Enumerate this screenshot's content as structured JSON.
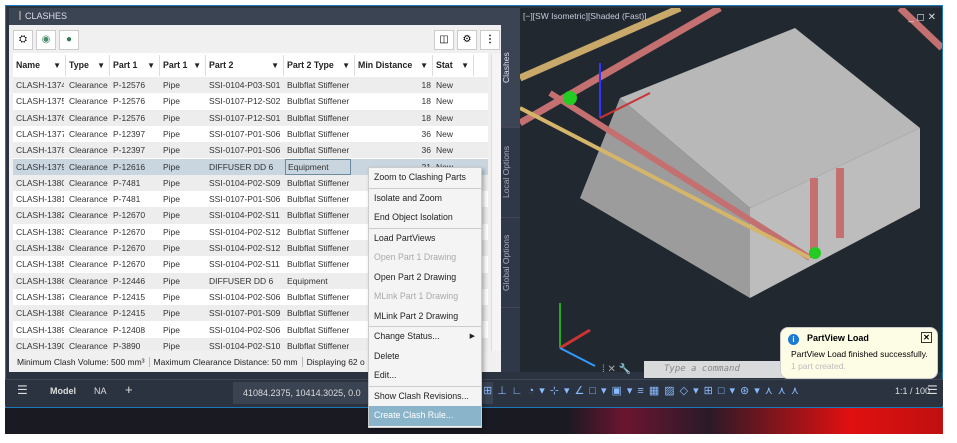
{
  "panel": {
    "title": "CLASHES",
    "toolbar_icons": [
      "clash-run-icon",
      "location-pin-icon",
      "globe-icon"
    ],
    "right_icons": [
      "columns-icon",
      "gear-icon",
      "more-vert-icon"
    ]
  },
  "columns": [
    "Name",
    "Type",
    "Part 1",
    "Part 1",
    "Part 2",
    "Part 2 Type",
    "Min Distance",
    "Stat"
  ],
  "rows": [
    [
      "CLASH-1374",
      "Clearance",
      "P-12576",
      "Pipe",
      "SSI-0104-P03-S01",
      "Bulbflat Stiffener",
      "18",
      "New"
    ],
    [
      "CLASH-1375",
      "Clearance",
      "P-12576",
      "Pipe",
      "SSI-0107-P12-S02",
      "Bulbflat Stiffener",
      "18",
      "New"
    ],
    [
      "CLASH-1376",
      "Clearance",
      "P-12576",
      "Pipe",
      "SSI-0107-P12-S01",
      "Bulbflat Stiffener",
      "18",
      "New"
    ],
    [
      "CLASH-1377",
      "Clearance",
      "P-12397",
      "Pipe",
      "SSI-0107-P01-S06",
      "Bulbflat Stiffener",
      "36",
      "New"
    ],
    [
      "CLASH-1378",
      "Clearance",
      "P-12397",
      "Pipe",
      "SSI-0107-P01-S06",
      "Bulbflat Stiffener",
      "36",
      "New"
    ],
    [
      "CLASH-1379",
      "Clearance",
      "P-12616",
      "Pipe",
      "DIFFUSER DD 6",
      "Equipment",
      "21",
      "New"
    ],
    [
      "CLASH-1380",
      "Clearance",
      "P-7481",
      "Pipe",
      "SSI-0104-P02-S09",
      "Bulbflat Stiffener",
      "",
      ""
    ],
    [
      "CLASH-1381",
      "Clearance",
      "P-7481",
      "Pipe",
      "SSI-0107-P01-S06",
      "Bulbflat Stiffener",
      "",
      ""
    ],
    [
      "CLASH-1382",
      "Clearance",
      "P-12670",
      "Pipe",
      "SSI-0104-P02-S11",
      "Bulbflat Stiffener",
      "",
      ""
    ],
    [
      "CLASH-1383",
      "Clearance",
      "P-12670",
      "Pipe",
      "SSI-0104-P02-S12",
      "Bulbflat Stiffener",
      "",
      ""
    ],
    [
      "CLASH-1384",
      "Clearance",
      "P-12670",
      "Pipe",
      "SSI-0104-P02-S12",
      "Bulbflat Stiffener",
      "",
      ""
    ],
    [
      "CLASH-1385",
      "Clearance",
      "P-12670",
      "Pipe",
      "SSI-0104-P02-S11",
      "Bulbflat Stiffener",
      "",
      ""
    ],
    [
      "CLASH-1386",
      "Clearance",
      "P-12446",
      "Pipe",
      "DIFFUSER DD 6",
      "Equipment",
      "",
      ""
    ],
    [
      "CLASH-1387",
      "Clearance",
      "P-12415",
      "Pipe",
      "SSI-0104-P02-S06",
      "Bulbflat Stiffener",
      "",
      ""
    ],
    [
      "CLASH-1388",
      "Clearance",
      "P-12415",
      "Pipe",
      "SSI-0107-P01-S09",
      "Bulbflat Stiffener",
      "",
      ""
    ],
    [
      "CLASH-1389",
      "Clearance",
      "P-12408",
      "Pipe",
      "SSI-0104-P02-S06",
      "Bulbflat Stiffener",
      "",
      ""
    ],
    [
      "CLASH-1390",
      "Clearance",
      "P-3890",
      "Pipe",
      "SSI-0104-P02-S10",
      "Bulbflat Stiffener",
      "",
      ""
    ]
  ],
  "selected_row": 5,
  "status": {
    "min_volume": "Minimum Clash Volume: 500 mm³",
    "max_clearance": "Maximum Clearance Distance: 50 mm",
    "displaying": "Displaying 62 o"
  },
  "side_tabs": [
    "Clashes",
    "Local Options",
    "Global Options"
  ],
  "viewport": {
    "label": "[−][SW Isometric][Shaded (Fast)]"
  },
  "context_menu": [
    {
      "label": "Zoom to Clashing Parts"
    },
    {
      "sep": true
    },
    {
      "label": "Isolate and Zoom"
    },
    {
      "label": "End Object Isolation"
    },
    {
      "sep": true
    },
    {
      "label": "Load PartViews"
    },
    {
      "label": "Open Part 1 Drawing",
      "disabled": true
    },
    {
      "label": "Open Part 2 Drawing"
    },
    {
      "label": "MLink Part 1 Drawing",
      "disabled": true
    },
    {
      "label": "MLink Part 2 Drawing"
    },
    {
      "sep": true
    },
    {
      "label": "Change Status...",
      "submenu": true
    },
    {
      "label": "Delete"
    },
    {
      "label": "Edit..."
    },
    {
      "sep": true
    },
    {
      "label": "Show Clash Revisions..."
    },
    {
      "label": "Create Clash Rule...",
      "highlighted": true
    }
  ],
  "toast": {
    "title": "PartView Load",
    "message": "PartView Load finished successfully.",
    "detail": "1 part created."
  },
  "command": {
    "placeholder": "Type  a  command"
  },
  "bottom": {
    "model_tab": "Model",
    "layout_tab": "NA",
    "add": "+",
    "coords": "41084.2375, 10414.3025, 0.0",
    "scale": "1:1 / 100"
  }
}
